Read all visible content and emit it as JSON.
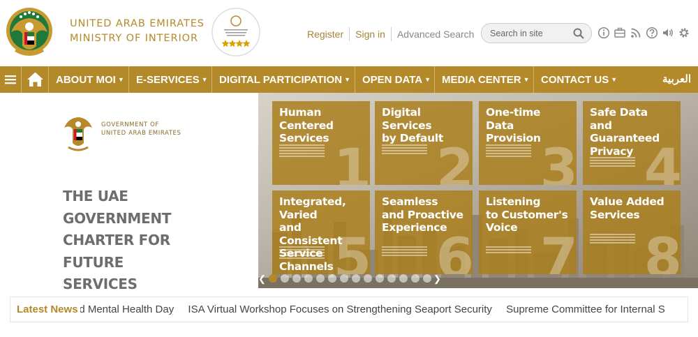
{
  "header": {
    "title_line1": "UNITED ARAB EMIRATES",
    "title_line2": "MINISTRY OF INTERIOR",
    "links": {
      "register": "Register",
      "sign_in": "Sign in",
      "advanced_search": "Advanced Search"
    },
    "search": {
      "placeholder": "Search in site"
    },
    "utility_icons": [
      "info-icon",
      "briefcase-icon",
      "rss-icon",
      "help-icon",
      "audio-icon",
      "settings-icon"
    ]
  },
  "nav": {
    "home_icon": "home-icon",
    "menu_icon": "hamburger-icon",
    "items": [
      "ABOUT MOI",
      "E-SERVICES",
      "DIGITAL PARTICIPATION",
      "OPEN DATA",
      "MEDIA CENTER",
      "CONTACT US"
    ],
    "arabic": "العربية"
  },
  "hero": {
    "gov_logo_line1": "GOVERNMENT OF",
    "gov_logo_line2": "UNITED ARAB EMIRATES",
    "charter_lines": [
      "THE UAE GOVERNMENT",
      "CHARTER FOR FUTURE",
      "SERVICES"
    ],
    "tiles": [
      {
        "title": [
          "Human Centered",
          "Services"
        ],
        "number": "1"
      },
      {
        "title": [
          "Digital Services",
          "by Default"
        ],
        "number": "2"
      },
      {
        "title": [
          "One-time Data",
          "Provision"
        ],
        "number": "3"
      },
      {
        "title": [
          "Safe Data",
          "and Guaranteed",
          "Privacy"
        ],
        "number": "4"
      },
      {
        "title": [
          "Integrated, Varied",
          "and Consistent",
          "Service Channels"
        ],
        "number": "5"
      },
      {
        "title": [
          "Seamless",
          "and Proactive",
          "Experience"
        ],
        "number": "6"
      },
      {
        "title": [
          "Listening",
          "to Customer's",
          "Voice"
        ],
        "number": "7"
      },
      {
        "title": [
          "Value Added",
          "Services"
        ],
        "number": "8"
      }
    ],
    "slides_count": 14,
    "active_slide": 0
  },
  "news": {
    "label": "Latest News",
    "items": [
      "rld Mental Health Day",
      "ISA Virtual Workshop Focuses on Strengthening Seaport Security",
      "Supreme Committee for Internal S"
    ]
  },
  "colors": {
    "brand_gold": "#b3892a",
    "gold_text": "#b48a2a"
  }
}
